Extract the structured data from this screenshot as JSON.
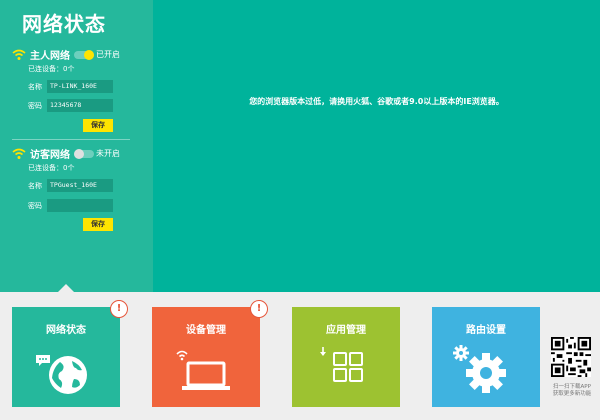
{
  "panel": {
    "title": "网络状态",
    "host": {
      "name": "主人网络",
      "status": "已开启",
      "enabled": true,
      "devices": "已连设备：0个",
      "name_label": "名称",
      "name_value": "TP-LINK_160E",
      "pwd_label": "密码",
      "pwd_value": "12345678",
      "save": "保存"
    },
    "guest": {
      "name": "访客网络",
      "status": "未开启",
      "enabled": false,
      "devices": "已连设备：0个",
      "name_label": "名称",
      "name_value": "TPGuest_160E",
      "pwd_label": "密码",
      "pwd_value": "",
      "save": "保存"
    }
  },
  "notice": "您的浏览器版本过低，请换用火狐、谷歌或者9.0以上版本的IE浏览器。",
  "tiles": [
    {
      "label": "网络状态",
      "color": "#25b89c",
      "badge": "!"
    },
    {
      "label": "设备管理",
      "color": "#f0643c",
      "badge": "!"
    },
    {
      "label": "应用管理",
      "color": "#9dc231",
      "badge": ""
    },
    {
      "label": "路由设置",
      "color": "#3fb3e0",
      "badge": ""
    }
  ],
  "qr": {
    "line1": "扫一扫下载APP",
    "line2": "获取更多新功能"
  },
  "colors": {
    "yellow": "#ffe400",
    "knob_on": "#ffe400",
    "knob_off": "#e0e0e0"
  }
}
